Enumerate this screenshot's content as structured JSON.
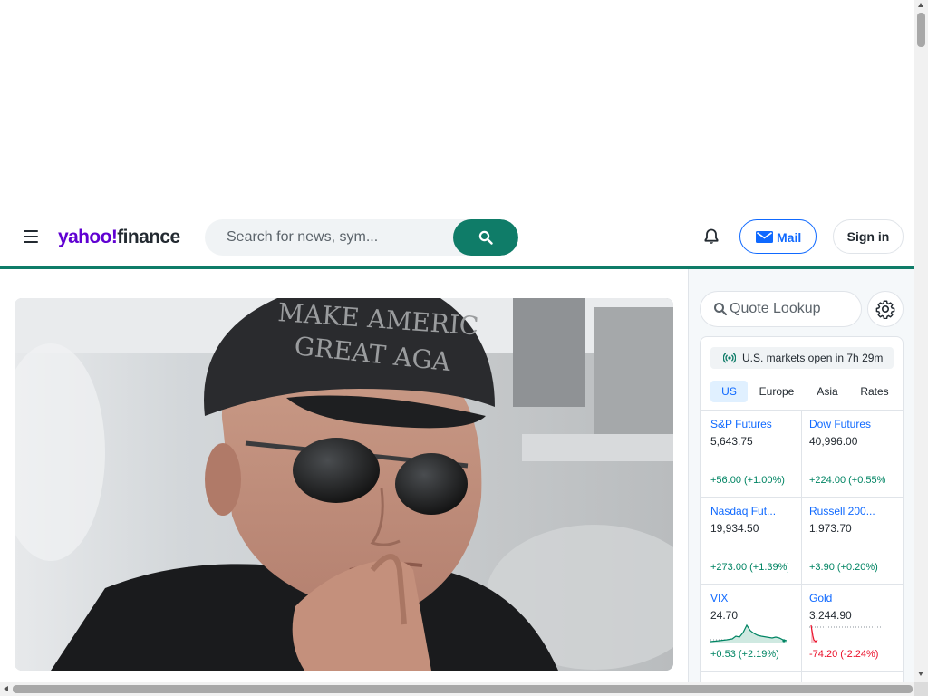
{
  "brand": {
    "logo_yahoo": "yahoo!",
    "logo_finance": "finance",
    "accent_color": "#0f7c68",
    "logo_color": "#6001d2"
  },
  "header": {
    "menu_icon": "hamburger-menu-icon",
    "search": {
      "placeholder": "Search for news, sym...",
      "button_icon": "search-icon"
    },
    "notifications_icon": "bell-icon",
    "mail_label": "Mail",
    "signin_label": "Sign in"
  },
  "hero": {
    "image_alt": "Man in black cap reading MAKE AMERICA GREAT AGAIN wearing aviator sunglasses"
  },
  "sidebar": {
    "quote_lookup_placeholder": "Quote Lookup",
    "settings_icon": "gear-icon",
    "market_status": "U.S. markets open in 7h 29m",
    "tabs": [
      {
        "label": "US",
        "active": true
      },
      {
        "label": "Europe",
        "active": false
      },
      {
        "label": "Asia",
        "active": false
      },
      {
        "label": "Rates",
        "active": false
      }
    ],
    "quotes": [
      {
        "name": "S&P Futures",
        "price": "5,643.75",
        "change": "+56.00 (+1.00%)",
        "direction": "up"
      },
      {
        "name": "Dow Futures",
        "price": "40,996.00",
        "change": "+224.00 (+0.55%)",
        "direction": "up"
      },
      {
        "name": "Nasdaq Fut...",
        "price": "19,934.50",
        "change": "+273.00 (+1.39%)",
        "direction": "up"
      },
      {
        "name": "Russell 200...",
        "price": "1,973.70",
        "change": "+3.90 (+0.20%)",
        "direction": "up"
      },
      {
        "name": "VIX",
        "price": "24.70",
        "change": "+0.53 (+2.19%)",
        "direction": "up"
      },
      {
        "name": "Gold",
        "price": "3,244.90",
        "change": "-74.20 (-2.24%)",
        "direction": "down"
      }
    ]
  }
}
